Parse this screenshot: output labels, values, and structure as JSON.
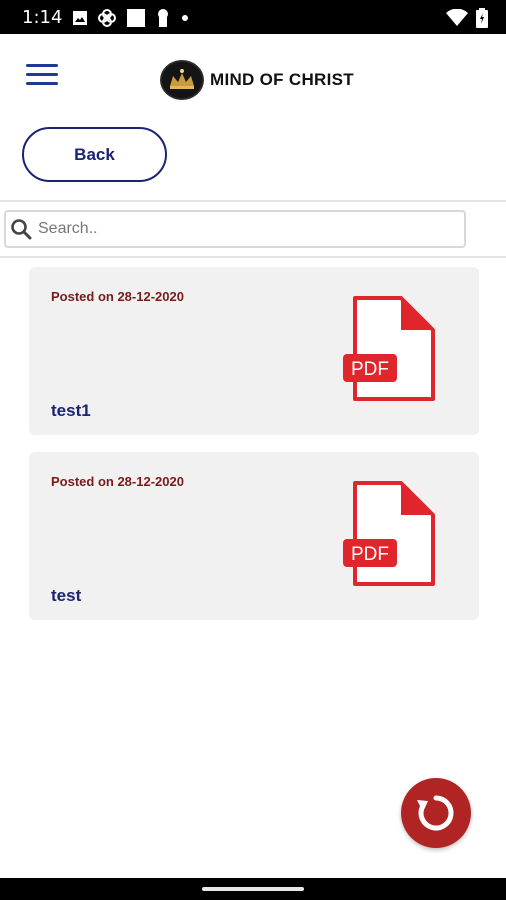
{
  "status_bar": {
    "time": "1:14"
  },
  "header": {
    "app_title": "MIND OF CHRIST"
  },
  "back_button": {
    "label": "Back"
  },
  "search": {
    "placeholder": "Search..",
    "value": ""
  },
  "posts": [
    {
      "date": "Posted on 28-12-2020",
      "title": "test1",
      "file_type": "PDF"
    },
    {
      "date": "Posted on 28-12-2020",
      "title": "test",
      "file_type": "PDF"
    }
  ],
  "colors": {
    "primary_navy": "#1b2470",
    "date_maroon": "#7a1b1b",
    "pdf_red": "#e0262c",
    "fab_red": "#b12424",
    "card_bg": "#f1f1f1"
  },
  "icons": {
    "menu": "hamburger-icon",
    "search": "search-icon",
    "document": "pdf-file-icon",
    "refresh": "refresh-icon"
  }
}
